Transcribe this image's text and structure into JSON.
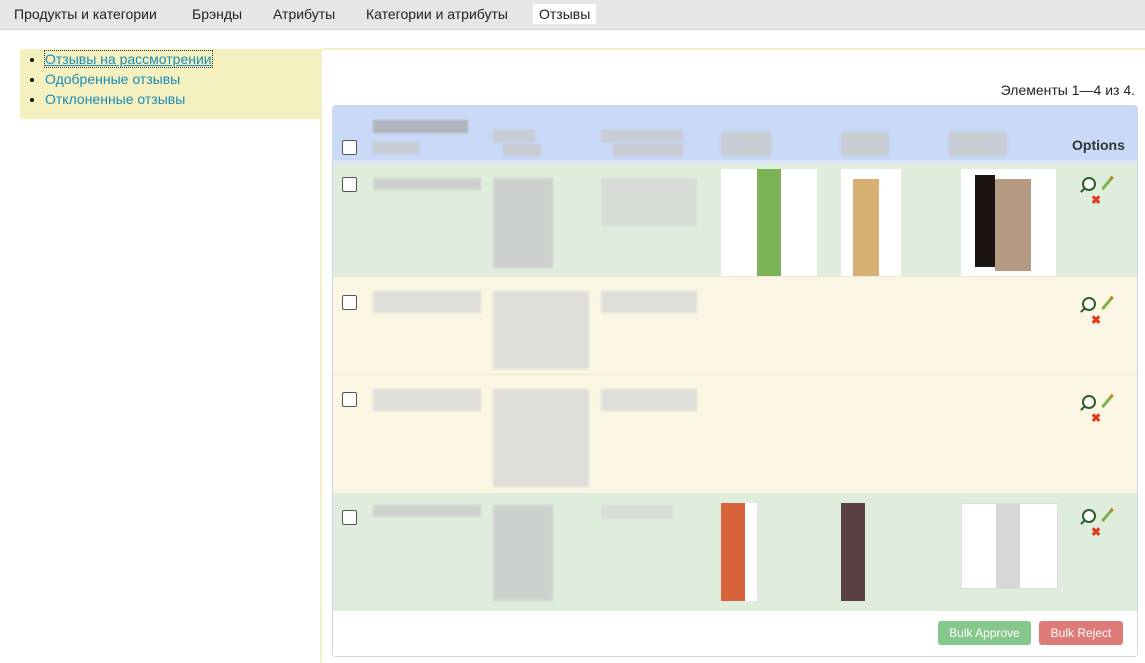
{
  "topnav": {
    "tabs": [
      {
        "label": "Продукты и категории",
        "active": false
      },
      {
        "label": "Брэнды",
        "active": false
      },
      {
        "label": "Атрибуты",
        "active": false
      },
      {
        "label": "Категории и атрибуты",
        "active": false
      },
      {
        "label": "Отзывы",
        "active": true
      }
    ]
  },
  "sidebar": {
    "items": [
      {
        "label": "Отзывы на рассмотрении",
        "current": true
      },
      {
        "label": "Одобренные отзывы",
        "current": false
      },
      {
        "label": "Отклоненные отзывы",
        "current": false
      }
    ]
  },
  "pager": {
    "text": "Элементы 1—4 из 4."
  },
  "grid": {
    "options_label": "Options",
    "row_count": 4
  },
  "buttons": {
    "approve": "Bulk Approve",
    "reject": "Bulk Reject"
  },
  "colors": {
    "header": "#c9d9f7",
    "row_green": "#dfeedc",
    "row_cream": "#fbf6e4",
    "sidebar": "#f5f0bf",
    "link": "#1a8bb5",
    "approve": "#86c78b",
    "reject": "#de7b79"
  },
  "icons": [
    "view-icon",
    "edit-icon",
    "delete-icon"
  ]
}
